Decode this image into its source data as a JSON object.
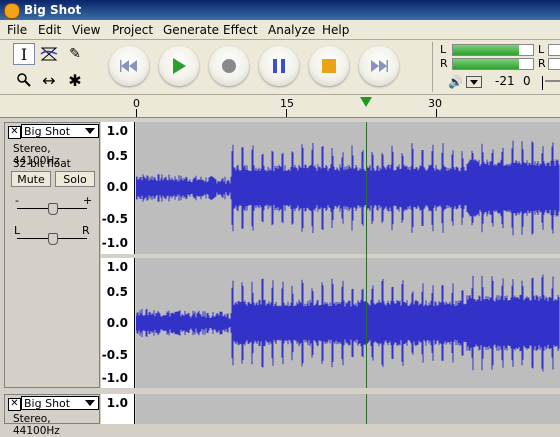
{
  "window": {
    "title": "Big Shot"
  },
  "menu": [
    "File",
    "Edit",
    "View",
    "Project",
    "Generate",
    "Effect",
    "Analyze",
    "Help"
  ],
  "tools": [
    {
      "name": "selection-tool",
      "glyph": "I",
      "selected": true
    },
    {
      "name": "envelope-tool",
      "glyph": "⧖",
      "selected": false
    },
    {
      "name": "draw-tool",
      "glyph": "✎",
      "selected": false
    },
    {
      "name": "zoom-tool",
      "glyph": "🔍",
      "selected": false
    },
    {
      "name": "timeshift-tool",
      "glyph": "↔",
      "selected": false
    },
    {
      "name": "multi-tool",
      "glyph": "✱",
      "selected": false
    }
  ],
  "transport": [
    "skip-to-start",
    "play",
    "record",
    "pause",
    "stop",
    "skip-to-end"
  ],
  "meter": {
    "left_label": "L",
    "right_label": "R",
    "db_value": "-21",
    "zero_value": "0",
    "left_level": 0.82,
    "right_level": 0.82
  },
  "ruler": {
    "labels": [
      "0",
      "15",
      "30"
    ]
  },
  "track": {
    "name": "Big Shot",
    "format": "Stereo, 44100Hz",
    "bit_depth": "32-bit float",
    "mute_label": "Mute",
    "solo_label": "Solo",
    "gain_minus": "-",
    "gain_plus": "+",
    "pan_left": "L",
    "pan_right": "R",
    "gain_level": 0.5,
    "pan_level": 0.5,
    "scale": [
      "1.0",
      "0.5",
      "0.0",
      "-0.5",
      "-1.0"
    ]
  },
  "track2": {
    "name": "Big Shot",
    "format": "Stereo, 44100Hz",
    "scale_top": "1.0"
  },
  "colors": {
    "wave": "#3232c8",
    "wave_bg": "#bdbdbd",
    "playhead": "#2e6b2e"
  }
}
